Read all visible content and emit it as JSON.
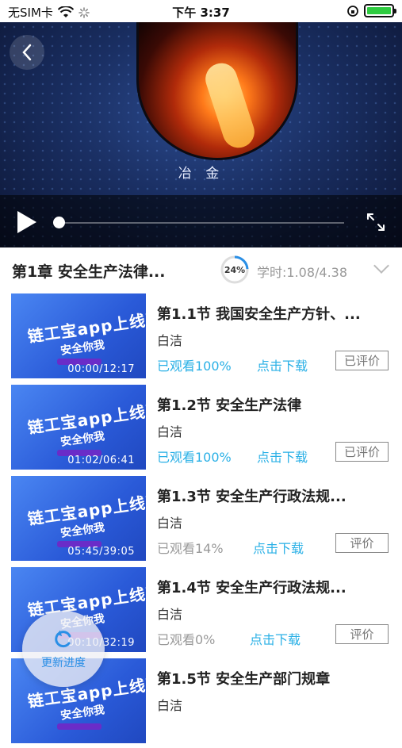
{
  "status_bar": {
    "carrier": "无SIM卡",
    "time": "下午 3:37"
  },
  "video": {
    "caption": "冶 金"
  },
  "chapter": {
    "title": "第1章  安全生产法律...",
    "progress": "24%",
    "progress_fraction": 0.24,
    "hours": "学时:1.08/4.38"
  },
  "lessons": [
    {
      "title": "第1.1节 我国安全生产方针、...",
      "teacher": "白洁",
      "watched": "已观看100%",
      "watched_color": "#2ab0e6",
      "download": "点击下载",
      "rate": "已评价",
      "duration": "00:00/12:17"
    },
    {
      "title": "第1.2节 安全生产法律",
      "teacher": "白洁",
      "watched": "已观看100%",
      "watched_color": "#2ab0e6",
      "download": "点击下载",
      "rate": "已评价",
      "duration": "01:02/06:41"
    },
    {
      "title": "第1.3节 安全生产行政法规...",
      "teacher": "白洁",
      "watched": "已观看14%",
      "watched_color": "#999999",
      "download": "点击下载",
      "rate": "评价",
      "duration": "05:45/39:05"
    },
    {
      "title": "第1.4节 安全生产行政法规...",
      "teacher": "白洁",
      "watched": "已观看0%",
      "watched_color": "#999999",
      "download": "点击下载",
      "rate": "评价",
      "duration": "00:10/32:19"
    },
    {
      "title": "第1.5节 安全生产部门规章",
      "teacher": "白洁",
      "watched": "",
      "watched_color": "#999999",
      "download": "",
      "rate": "",
      "duration": ""
    }
  ],
  "thumb_text": {
    "line1": "链工宝app上线啦!",
    "line2": "安全你我"
  },
  "update_button": {
    "label": "更新进度"
  }
}
